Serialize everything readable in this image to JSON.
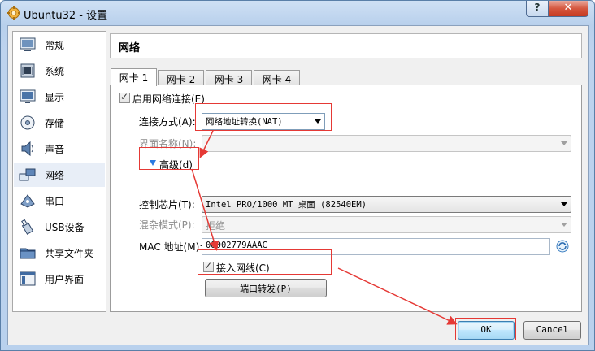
{
  "window": {
    "title": "Ubuntu32 - 设置",
    "help_glyph": "?",
    "close_glyph": "✕"
  },
  "sidebar": {
    "items": [
      {
        "label": "常规",
        "icon": "general-icon"
      },
      {
        "label": "系统",
        "icon": "system-icon"
      },
      {
        "label": "显示",
        "icon": "display-icon"
      },
      {
        "label": "存储",
        "icon": "storage-icon"
      },
      {
        "label": "声音",
        "icon": "audio-icon"
      },
      {
        "label": "网络",
        "icon": "network-icon",
        "selected": true
      },
      {
        "label": "串口",
        "icon": "serial-port-icon"
      },
      {
        "label": "USB设备",
        "icon": "usb-icon"
      },
      {
        "label": "共享文件夹",
        "icon": "shared-folder-icon"
      },
      {
        "label": "用户界面",
        "icon": "user-interface-icon"
      }
    ]
  },
  "header": {
    "title": "网络"
  },
  "tabs": [
    "网卡 1",
    "网卡 2",
    "网卡 3",
    "网卡 4"
  ],
  "network": {
    "enable_label": "启用网络连接(E)",
    "enable_checked": true,
    "attached_label": "连接方式(A):",
    "attached_value": "网络地址转换(NAT)",
    "name_label": "界面名称(N):",
    "name_value": "",
    "advanced_label": "高级(d)",
    "adapter_label": "控制芯片(T):",
    "adapter_value": "Intel PRO/1000 MT 桌面 (82540EM)",
    "promisc_label": "混杂模式(P):",
    "promisc_value": "拒绝",
    "mac_label": "MAC 地址(M):",
    "mac_value": "08002779AAAC",
    "cable_label": "接入网线(C)",
    "cable_checked": true,
    "port_forward_label": "端口转发(P)"
  },
  "footer": {
    "ok_label": "OK",
    "cancel_label": "Cancel"
  },
  "colors": {
    "annotation_red": "#e53935",
    "accent": "#3c7fb1"
  }
}
